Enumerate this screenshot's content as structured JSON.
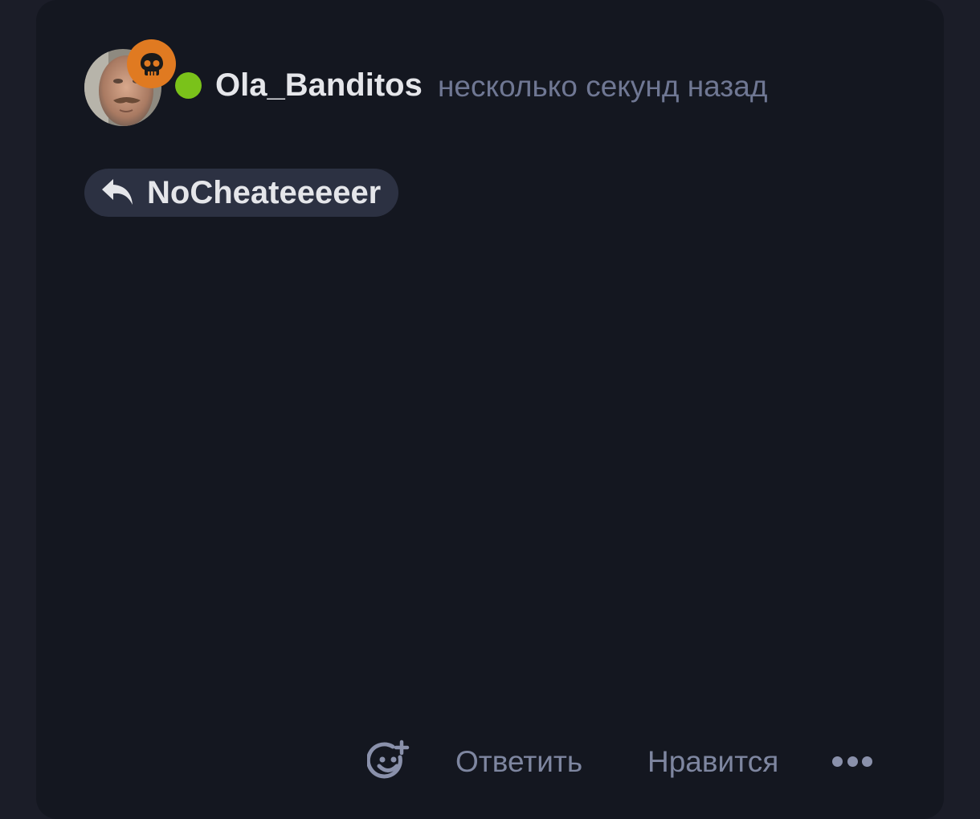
{
  "post": {
    "author": {
      "username": "Ola_Banditos",
      "avatar_icon": "user-photo",
      "badge_icon": "skull-icon",
      "badge_color": "#e07a21",
      "online": true,
      "online_color": "#7ac21a"
    },
    "timestamp": "несколько секунд назад",
    "reply_to": {
      "icon": "reply-arrow-icon",
      "username": "NoCheateeeeer"
    }
  },
  "actions": {
    "react_icon": "emoji-add-icon",
    "reply_label": "Ответить",
    "like_label": "Нравится",
    "more_icon": "more-dots-icon"
  }
}
